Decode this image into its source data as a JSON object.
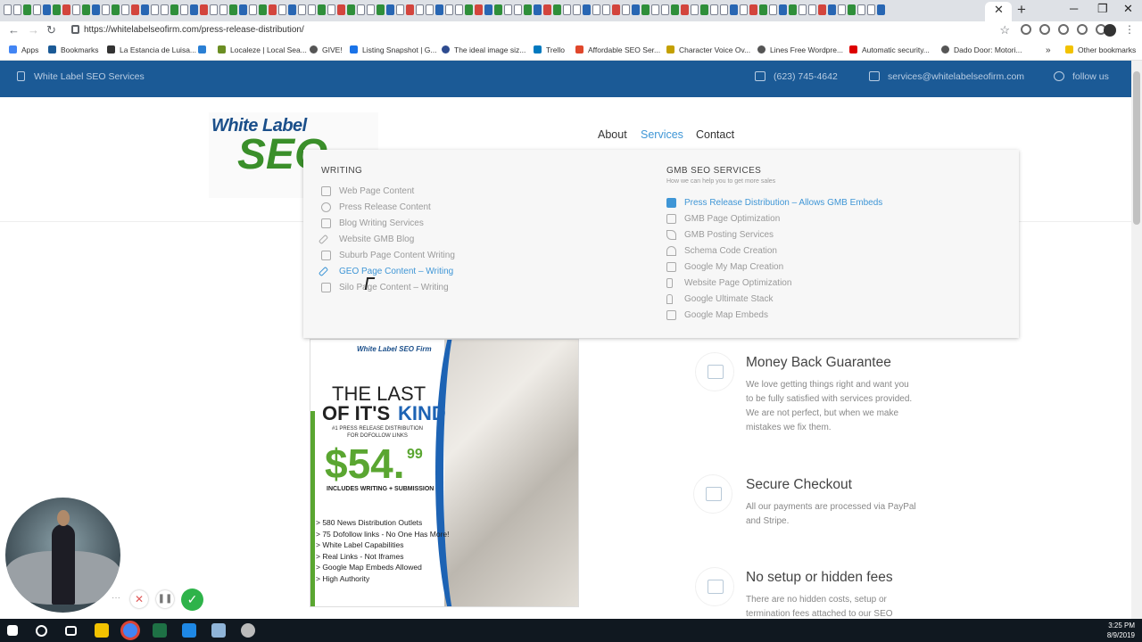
{
  "browser": {
    "url": "https://whitelabelseofirm.com/press-release-distribution/",
    "bookmarks": [
      "Apps",
      "Bookmarks",
      "La Estancia de Luisa...",
      "Localeze | Local Sea...",
      "GIVE!",
      "Listing Snapshot | G...",
      "The ideal image siz...",
      "Trello",
      "Affordable SEO Ser...",
      "Character Voice Ov...",
      "Lines Free Wordpre...",
      "Automatic security...",
      "Dado Door: Motori...",
      "Other bookmarks"
    ]
  },
  "topbar": {
    "brand": "White Label SEO Services",
    "phone": "(623) 745-4642",
    "email": "services@whitelabelseofirm.com",
    "follow": "follow us"
  },
  "logo": {
    "line1": "White Label",
    "line2": "SEO"
  },
  "nav": {
    "about": "About",
    "services": "Services",
    "contact": "Contact"
  },
  "menu": {
    "writing_title": "WRITING",
    "writing": [
      "Web Page Content",
      "Press Release Content",
      "Blog Writing Services",
      "Website GMB Blog",
      "Suburb Page Content Writing",
      "GEO Page Content – Writing",
      "Silo Page Content – Writing"
    ],
    "gmb_title": "GMB SEO SERVICES",
    "gmb_sub": "How we can help you to get more sales",
    "gmb": [
      "Press Release Distribution – Allows GMB Embeds",
      "GMB Page Optimization",
      "GMB Posting Services",
      "Schema Code Creation",
      "Google My Map Creation",
      "Website Page Optimization",
      "Google Ultimate Stack",
      "Google Map Embeds"
    ]
  },
  "ad": {
    "brand": "White Label SEO Firm",
    "headline1": "THE LAST",
    "headline2a": "OF IT'S",
    "headline2b": "KIND",
    "sub": "#1 PRESS RELEASE DISTRIBUTION FOR DOFOLLOW LINKS",
    "price_dollar": "$54.",
    "price_cents": "99",
    "includes": "INCLUDES WRITING + SUBMISSION",
    "bullets": [
      "> 580 News Distribution Outlets",
      "> 75 Dofollow links - No One Has More!",
      "> White Label Capabilities",
      "> Real Links - Not Iframes",
      "> Google Map Embeds Allowed",
      "> High Authority"
    ]
  },
  "features": [
    {
      "title": "Money Back Guarantee",
      "text": [
        "We love getting things right and want you",
        "to be fully satisfied with services provided.",
        "We are not perfect, but when we make",
        "mistakes we fix them."
      ]
    },
    {
      "title": "Secure Checkout",
      "text": [
        "All our payments are processed via PayPal",
        "and Stripe."
      ]
    },
    {
      "title": "No setup or hidden fees",
      "text": [
        "There are no hidden costs, setup or",
        "termination fees attached to our SEO"
      ]
    }
  ],
  "clock": {
    "time": "3:25 PM",
    "date": "8/9/2019"
  },
  "colors": {
    "brand_blue": "#1b5a96",
    "link_blue": "#3f96d6",
    "green": "#3a8f2a"
  }
}
